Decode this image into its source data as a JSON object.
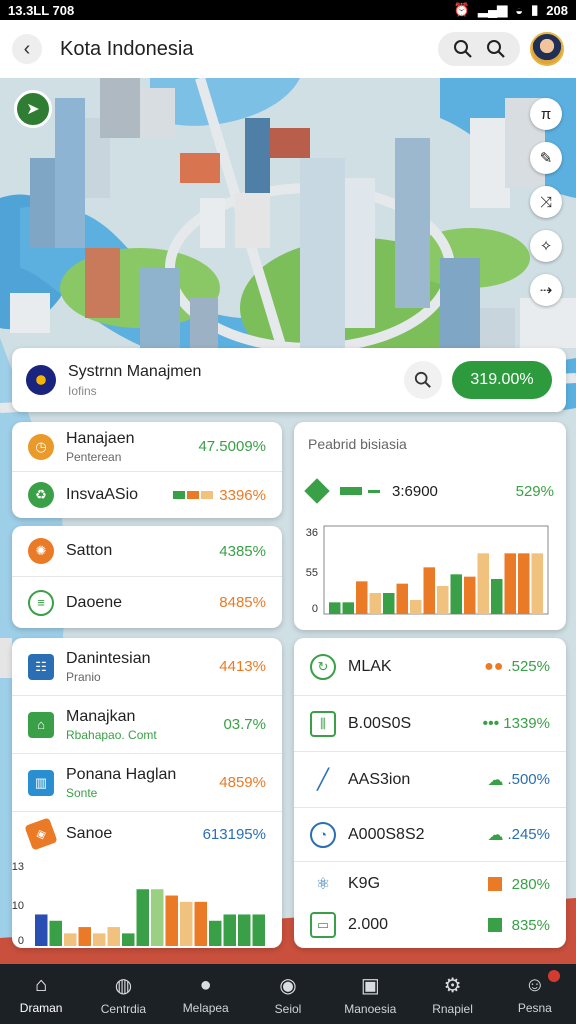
{
  "status_bar": {
    "left": "13.3LL 708",
    "right": "208"
  },
  "app_bar": {
    "title": "Kota Indonesia"
  },
  "system_card": {
    "title": "Systrnn Manajmen",
    "subtitle": "Iofins",
    "badge": "319.00%"
  },
  "left_top": {
    "rows": [
      {
        "name": "Hanajaen",
        "sub": "Penterean",
        "value": "47.5009%",
        "color": "#ea9a2b"
      },
      {
        "name": "InsvaASio",
        "value": "3396%",
        "color": "#3aa047"
      }
    ]
  },
  "left_mid": {
    "rows": [
      {
        "name": "Satton",
        "value": "4385%",
        "color": "#ea7a25"
      },
      {
        "name": "Daoene",
        "value": "8485%",
        "color": "#3aa047"
      }
    ]
  },
  "left_bottom": {
    "rows": [
      {
        "name": "Danintesian",
        "sub": "Pranio",
        "value": "4413%",
        "color": "#2a6fb3"
      },
      {
        "name": "Manajkan",
        "sub": "Rbahapao. Comt",
        "value": "03.7%",
        "color": "#3aa047"
      },
      {
        "name": "Ponana Haglan",
        "sub": "Sonte",
        "value": "4859%",
        "color": "#2a8fd0"
      },
      {
        "name": "Sanoe",
        "value": "613195%",
        "color": "#ea7a25"
      }
    ]
  },
  "right_top": {
    "title": "Peabrid bisiasia",
    "legend_value": "3:6900",
    "legend_percent": "529%"
  },
  "right_bottom": {
    "rows": [
      {
        "name": "MLAK",
        "value": ".525%",
        "color": "#3aa047"
      },
      {
        "name": "B.00S0S",
        "value": "1339%",
        "color": "#3aa047"
      },
      {
        "name": "AAS3ion",
        "value": ".500%",
        "color": "#2a6fb3"
      },
      {
        "name": "A000S8S2",
        "value": ".245%",
        "color": "#2a6fb3"
      },
      {
        "name": "K9G",
        "value": "280%",
        "color": "#2a6fb3"
      },
      {
        "name": "2.000",
        "value": "835%",
        "color": "#3aa047"
      }
    ]
  },
  "chart_data": [
    {
      "type": "bar",
      "yticks": [
        "36",
        "55",
        "0"
      ],
      "ylim": [
        0,
        36
      ],
      "values": [
        5,
        5,
        14,
        9,
        9,
        13,
        6,
        20,
        12,
        17,
        16,
        26,
        15,
        26,
        26,
        26
      ],
      "colors": [
        "#3aa047",
        "#3aa047",
        "#ea7a25",
        "#f1c27d",
        "#3aa047",
        "#ea7a25",
        "#f1c27d",
        "#ea7a25",
        "#f1c27d",
        "#3aa047",
        "#ea7a25",
        "#f1c27d",
        "#3aa047",
        "#ea7a25",
        "#ea7a25",
        "#f1c27d"
      ]
    },
    {
      "type": "bar",
      "yticks": [
        "13",
        "10",
        "0"
      ],
      "ylim": [
        0,
        13
      ],
      "values": [
        5,
        4,
        2,
        3,
        2,
        3,
        2,
        9,
        9,
        8,
        7,
        7,
        4,
        5,
        5,
        5
      ],
      "colors": [
        "#2a4fb3",
        "#3aa047",
        "#f1c27d",
        "#ea7a25",
        "#f1c27d",
        "#f1c27d",
        "#3aa047",
        "#3aa047",
        "#9ad081",
        "#ea7a25",
        "#f1c27d",
        "#ea7a25",
        "#3aa047",
        "#3aa047",
        "#3aa047",
        "#3aa047"
      ]
    }
  ],
  "nav": [
    {
      "label": "Draman",
      "icon": "home-icon"
    },
    {
      "label": "Centrdia",
      "icon": "globe-icon"
    },
    {
      "label": "Melapea",
      "icon": "pin-icon"
    },
    {
      "label": "Seiol",
      "icon": "drop-icon"
    },
    {
      "label": "Manoesia",
      "icon": "document-icon"
    },
    {
      "label": "Rnapiel",
      "icon": "gear-icon"
    },
    {
      "label": "Pesna",
      "icon": "user-icon"
    }
  ]
}
